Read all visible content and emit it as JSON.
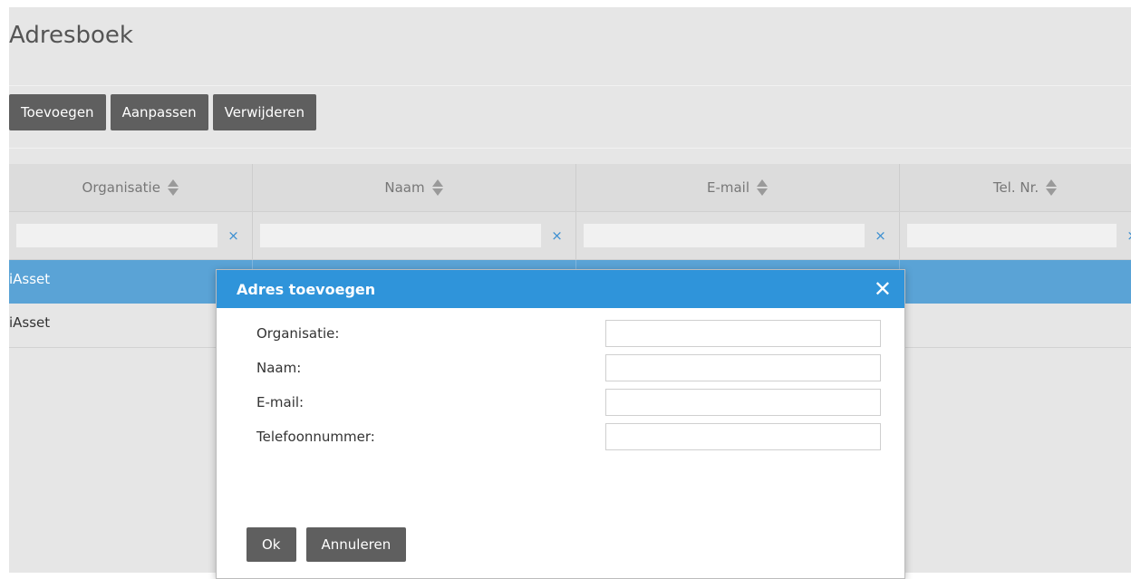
{
  "page": {
    "title": "Adresboek"
  },
  "toolbar": {
    "add_label": "Toevoegen",
    "edit_label": "Aanpassen",
    "delete_label": "Verwijderen"
  },
  "grid": {
    "columns": [
      {
        "label": "Organisatie"
      },
      {
        "label": "Naam"
      },
      {
        "label": "E-mail"
      },
      {
        "label": "Tel. Nr."
      }
    ],
    "filter_clear_glyph": "×",
    "rows": [
      {
        "organisatie": "iAsset",
        "naam": "",
        "email": "",
        "tel": "",
        "selected": true
      },
      {
        "organisatie": "iAsset",
        "naam": "",
        "email": "",
        "tel": "",
        "selected": false
      }
    ]
  },
  "dialog": {
    "title": "Adres toevoegen",
    "close_glyph": "✕",
    "fields": [
      {
        "label": "Organisatie:",
        "value": ""
      },
      {
        "label": "Naam:",
        "value": ""
      },
      {
        "label": "E-mail:",
        "value": ""
      },
      {
        "label": "Telefoonnummer:",
        "value": ""
      }
    ],
    "ok_label": "Ok",
    "cancel_label": "Annuleren"
  },
  "colors": {
    "accent": "#2f94da",
    "selected_row": "#5aa3d6",
    "button": "#5f5f5f",
    "background": "#e6e6e6"
  }
}
